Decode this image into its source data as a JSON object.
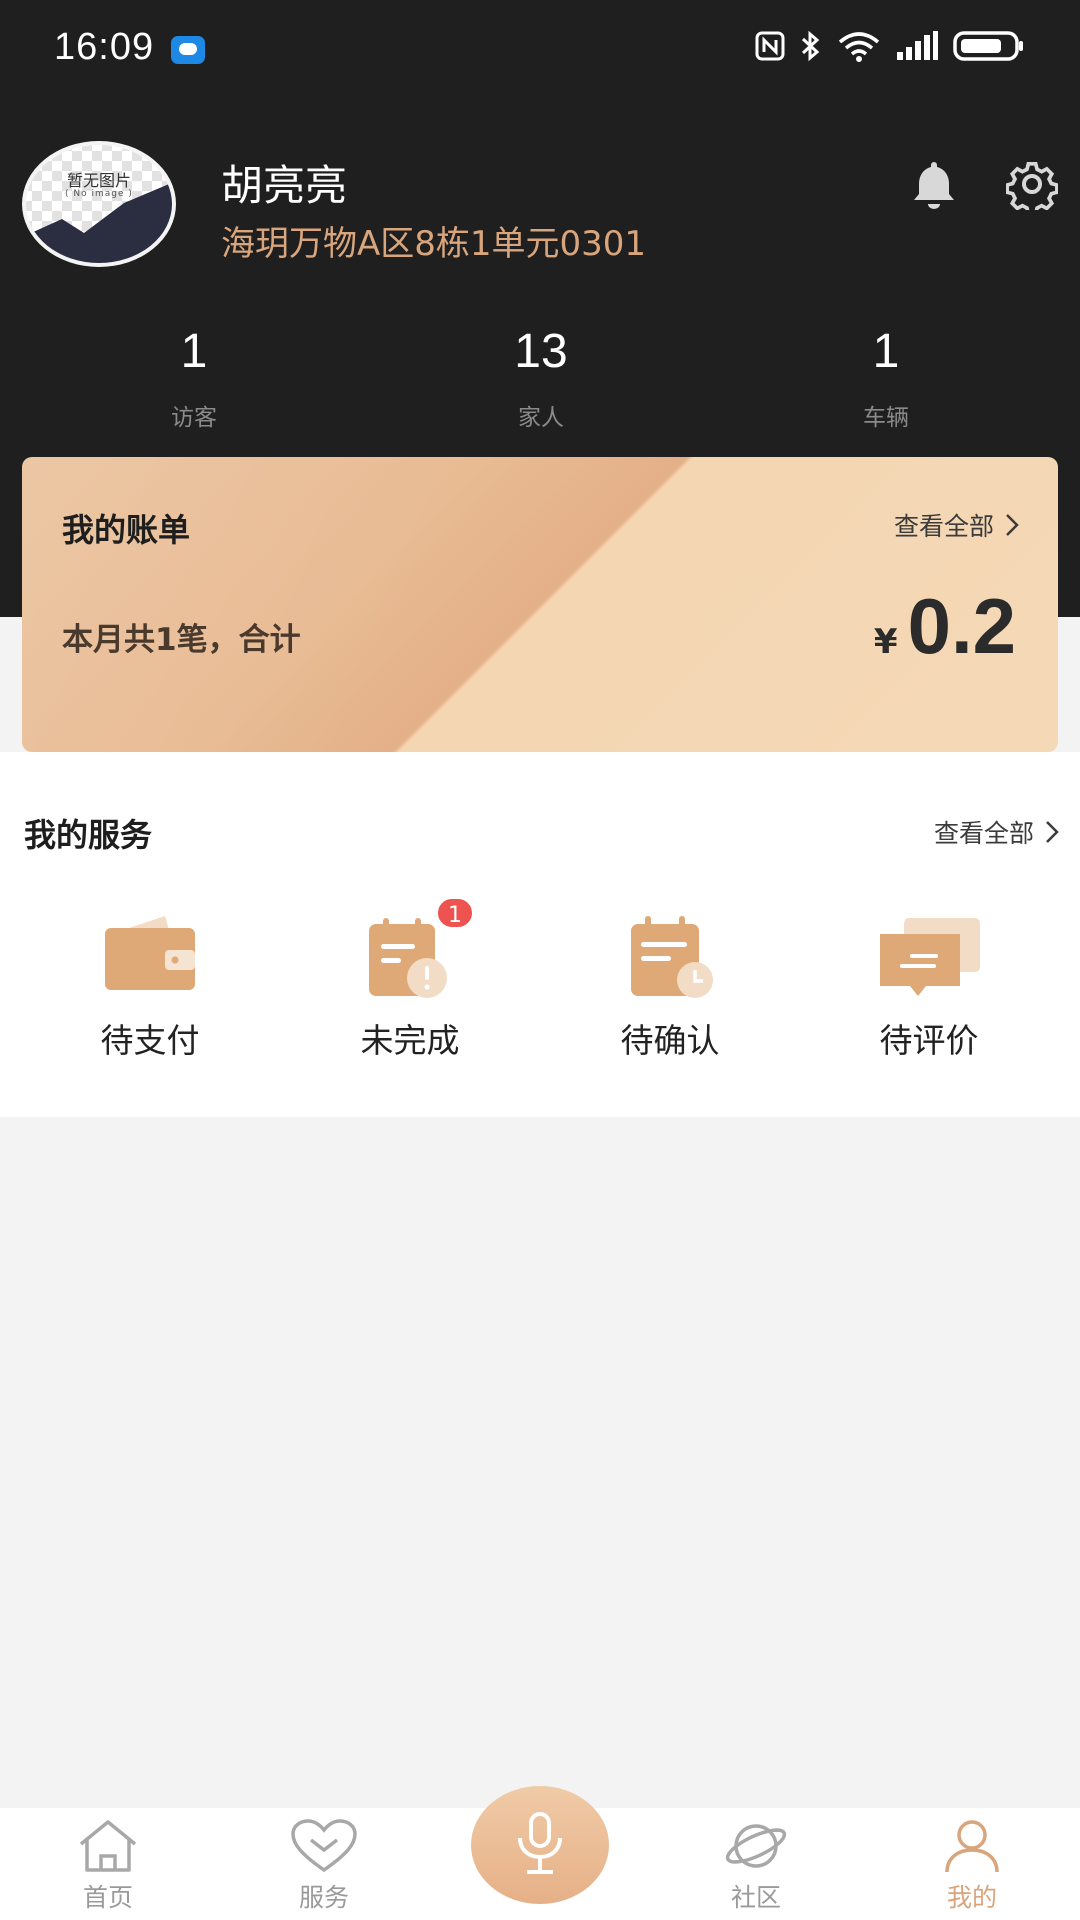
{
  "status_bar": {
    "time": "16:09"
  },
  "profile": {
    "avatar_text": "暂无图片",
    "avatar_subtext": "( No image )",
    "name": "胡亮亮",
    "address": "海玥万物A区8栋1单元0301"
  },
  "stats": [
    {
      "value": "1",
      "label": "访客"
    },
    {
      "value": "13",
      "label": "家人"
    },
    {
      "value": "1",
      "label": "车辆"
    }
  ],
  "bill": {
    "title": "我的账单",
    "view_all": "查看全部",
    "summary": "本月共1笔，合计",
    "currency": "¥",
    "amount": "0.2"
  },
  "services": {
    "title": "我的服务",
    "view_all": "查看全部",
    "items": [
      {
        "label": "待支付",
        "icon": "wallet-icon",
        "badge": null
      },
      {
        "label": "未完成",
        "icon": "clipboard-alert-icon",
        "badge": "1"
      },
      {
        "label": "待确认",
        "icon": "clipboard-clock-icon",
        "badge": null
      },
      {
        "label": "待评价",
        "icon": "chat-bubbles-icon",
        "badge": null
      }
    ]
  },
  "tabbar": {
    "items": [
      {
        "label": "首页",
        "icon": "home-icon"
      },
      {
        "label": "服务",
        "icon": "heart-icon"
      },
      {
        "label": "社区",
        "icon": "planet-icon"
      },
      {
        "label": "我的",
        "icon": "person-icon",
        "active": true
      }
    ],
    "center_icon": "microphone-icon"
  },
  "colors": {
    "header_bg": "#1f1f1f",
    "accent": "#d9a57c",
    "badge": "#ef5350",
    "icon_fill": "#dfa877"
  }
}
